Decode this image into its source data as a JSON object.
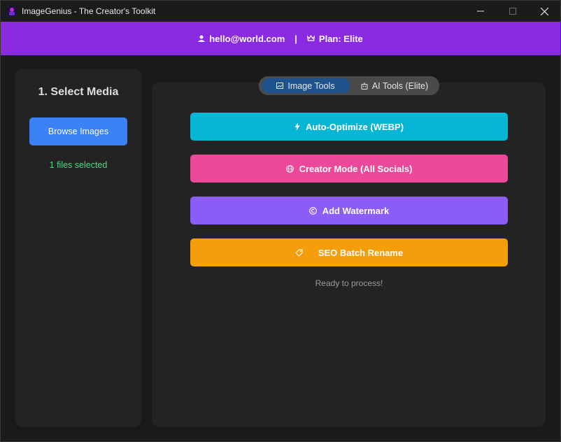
{
  "window": {
    "title": "ImageGenius - The Creator's Toolkit"
  },
  "header": {
    "email": "hello@world.com",
    "separator": "|",
    "plan": "Plan: Elite"
  },
  "sidebar": {
    "title": "1. Select Media",
    "browse_label": "Browse Images",
    "files_status": "1 files selected",
    "files_status_color": "#4ade80"
  },
  "tabs": [
    {
      "label": "Image Tools",
      "icon": "image-icon",
      "active": true
    },
    {
      "label": "AI Tools (Elite)",
      "icon": "robot-icon",
      "active": false
    }
  ],
  "actions": [
    {
      "label": "Auto-Optimize (WEBP)",
      "icon": "lightning-icon",
      "color": "#06b6d4"
    },
    {
      "label": "Creator Mode (All Socials)",
      "icon": "globe-icon",
      "color": "#ec4899"
    },
    {
      "label": "Add Watermark",
      "icon": "copyright-icon",
      "color": "#8b5cf6"
    },
    {
      "label": "SEO Batch Rename",
      "icon": "tag-icon",
      "color": "#f59e0b"
    }
  ],
  "status_text": "Ready to process!",
  "colors": {
    "header_bg": "#8a2be2",
    "browse_button": "#3b82f6",
    "active_tab": "#1f538d"
  }
}
